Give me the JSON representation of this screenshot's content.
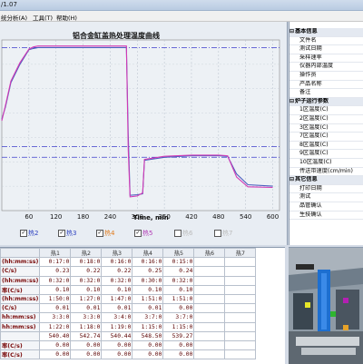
{
  "window": {
    "title": "/1.07"
  },
  "menu": [
    "统分析(A)",
    "工具(T)",
    "帮助(H)"
  ],
  "chart_data": {
    "type": "line",
    "title": "铝合金缸盖热处理温度曲线",
    "x_ticks": [
      "60",
      "120",
      "180",
      "240",
      "300",
      "360",
      "420",
      "480",
      "540",
      "600"
    ],
    "xlabel_tick": "Time, min",
    "x_range": [
      0,
      615
    ],
    "y_range": [
      0,
      560
    ],
    "series": [
      {
        "name": "热2",
        "color": "#4b5fbf",
        "x": [
          0,
          8,
          20,
          40,
          60,
          70,
          80,
          100,
          200,
          276,
          280,
          284,
          300,
          312,
          316,
          360,
          420,
          480,
          500,
          520,
          545,
          600
        ],
        "values": [
          300,
          340,
          420,
          480,
          528,
          532,
          535,
          535,
          535,
          535,
          250,
          50,
          52,
          55,
          165,
          175,
          180,
          180,
          178,
          120,
          85,
          80
        ]
      },
      {
        "name": "热3",
        "color": "#d23ab5",
        "x": [
          0,
          8,
          20,
          40,
          60,
          70,
          80,
          100,
          200,
          276,
          280,
          284,
          300,
          312,
          316,
          360,
          420,
          480,
          500,
          520,
          545,
          600
        ],
        "values": [
          295,
          345,
          425,
          485,
          530,
          537,
          540,
          540,
          540,
          540,
          200,
          45,
          48,
          58,
          168,
          178,
          182,
          182,
          180,
          110,
          78,
          76
        ]
      }
    ],
    "reference_levels": [
      535,
      210,
      175
    ]
  },
  "legend": [
    {
      "label": "热2",
      "checked": true,
      "color": "#2a3fbf"
    },
    {
      "label": "热3",
      "checked": true,
      "color": "#2a3fbf"
    },
    {
      "label": "热4",
      "checked": true,
      "color": "#e07a1a"
    },
    {
      "label": "热5",
      "checked": true,
      "color": "#b23ab5"
    },
    {
      "label": "热6",
      "checked": false,
      "color": "#bbbbbb"
    },
    {
      "label": "热7",
      "checked": false,
      "color": "#bbbbbb"
    }
  ],
  "info_panel": [
    {
      "text": "基本信息",
      "header": true
    },
    {
      "text": "文件名"
    },
    {
      "text": "测试日期"
    },
    {
      "text": "采样速率"
    },
    {
      "text": "仪器内部温度"
    },
    {
      "text": "操作员"
    },
    {
      "text": "产品名称"
    },
    {
      "text": "备注"
    },
    {
      "text": "炉子运行参数",
      "header": true
    },
    {
      "text": "1区温度(C)"
    },
    {
      "text": "2区温度(C)"
    },
    {
      "text": "3区温度(C)"
    },
    {
      "text": "7区温度(C)"
    },
    {
      "text": "8区温度(C)"
    },
    {
      "text": "9区温度(C)"
    },
    {
      "text": "10区温度(C)"
    },
    {
      "text": "传送带速度(cm/min)"
    },
    {
      "text": "其它信息",
      "header": true
    },
    {
      "text": "打印日期"
    },
    {
      "text": "测试"
    },
    {
      "text": "品管确认"
    },
    {
      "text": "生技确认"
    }
  ],
  "table": {
    "headers": [
      "",
      "热1",
      "热2",
      "热3",
      "热4",
      "热5",
      "热6",
      "热7"
    ],
    "rows": [
      {
        "label": "(hh:mm:ss)",
        "values": [
          "0:17:0",
          "0:18:0",
          "0:16:0",
          "0:16:0",
          "0:15:0",
          "",
          ""
        ]
      },
      {
        "label": "(C/s)",
        "values": [
          "0.23",
          "0.22",
          "0.22",
          "0.25",
          "0.24",
          "",
          ""
        ]
      },
      {
        "label": "(hh:mm:ss)",
        "values": [
          "0:32:0",
          "0:32:0",
          "0:32:0",
          "0:30:0",
          "0:32:0",
          "",
          ""
        ]
      },
      {
        "label": "率(C/s)",
        "values": [
          "0.10",
          "0.10",
          "0.10",
          "0.10",
          "0.10",
          "",
          ""
        ]
      },
      {
        "label": "(hh:mm:ss)",
        "values": [
          "1:50:0",
          "1:27:0",
          "1:47:0",
          "1:51:0",
          "1:51:0",
          "",
          ""
        ]
      },
      {
        "label": "(C/s)",
        "values": [
          "0.01",
          "0.01",
          "0.01",
          "0.01",
          "0.00",
          "",
          ""
        ]
      },
      {
        "label": "hh:mm:ss)",
        "values": [
          "3:3:0",
          "3:3:0",
          "3:4:0",
          "3:7:0",
          "3:7:0",
          "",
          ""
        ]
      },
      {
        "label": "hh:mm:ss)",
        "values": [
          "1:22:0",
          "1:18:0",
          "1:19:0",
          "1:15:0",
          "1:15:0",
          "",
          ""
        ]
      },
      {
        "label": "",
        "values": [
          "540.40",
          "542.74",
          "540.44",
          "548.50",
          "539.27",
          "",
          ""
        ]
      },
      {
        "label": "率(C/s)",
        "values": [
          "0.00",
          "0.00",
          "0.00",
          "0.00",
          "0.00",
          "",
          ""
        ]
      },
      {
        "label": "率(C/s)",
        "values": [
          "0.00",
          "0.00",
          "0.00",
          "0.00",
          "0.00",
          "",
          ""
        ]
      }
    ]
  }
}
